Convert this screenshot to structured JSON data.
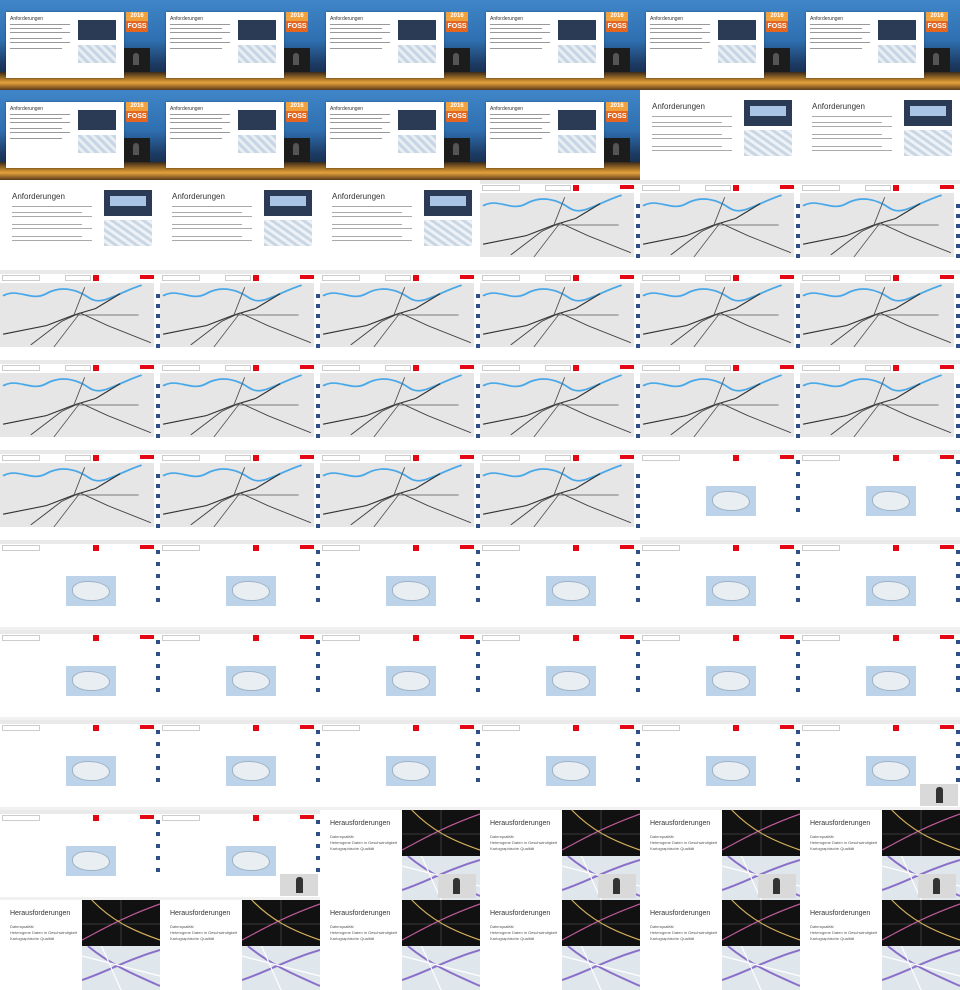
{
  "labels": {
    "requirements_title": "Anforderungen",
    "challenges_title": "Herausforderungen",
    "challenges_items": [
      "Datenqualität",
      "Heterogene Daten in Geschwindigkeit",
      "Kartographische Qualität"
    ],
    "conference_logo_year": "2016",
    "conference_logo_name": "FOSS"
  },
  "tiles": {
    "rows": [
      [
        "conf",
        "conf",
        "conf",
        "conf",
        "conf",
        "conf"
      ],
      [
        "conf",
        "conf",
        "conf",
        "conf",
        "slide",
        "slide"
      ],
      [
        "slide",
        "slide",
        "slide",
        "rail",
        "rail",
        "rail"
      ],
      [
        "rail",
        "rail",
        "rail",
        "rail",
        "rail",
        "rail"
      ],
      [
        "rail",
        "rail",
        "rail",
        "rail",
        "rail",
        "rail"
      ],
      [
        "rail",
        "rail",
        "rail",
        "rail",
        "swiss",
        "swiss"
      ],
      [
        "swiss",
        "swiss",
        "swiss",
        "swiss",
        "swiss",
        "swiss"
      ],
      [
        "swiss",
        "swiss",
        "swiss",
        "swiss",
        "swiss",
        "swiss"
      ],
      [
        "swiss",
        "swiss",
        "swiss",
        "swiss",
        "swiss",
        "swiss-cam"
      ],
      [
        "swiss",
        "swiss-cam",
        "chal-cam",
        "chal-cam",
        "chal-cam",
        "chal-cam"
      ],
      [
        "chal",
        "chal",
        "chal",
        "chal",
        "chal",
        "chal"
      ]
    ]
  },
  "colors": {
    "accent_red": "#e30613",
    "map_blue_river": "#4aa8e8",
    "control_blue": "#2f4f86"
  }
}
